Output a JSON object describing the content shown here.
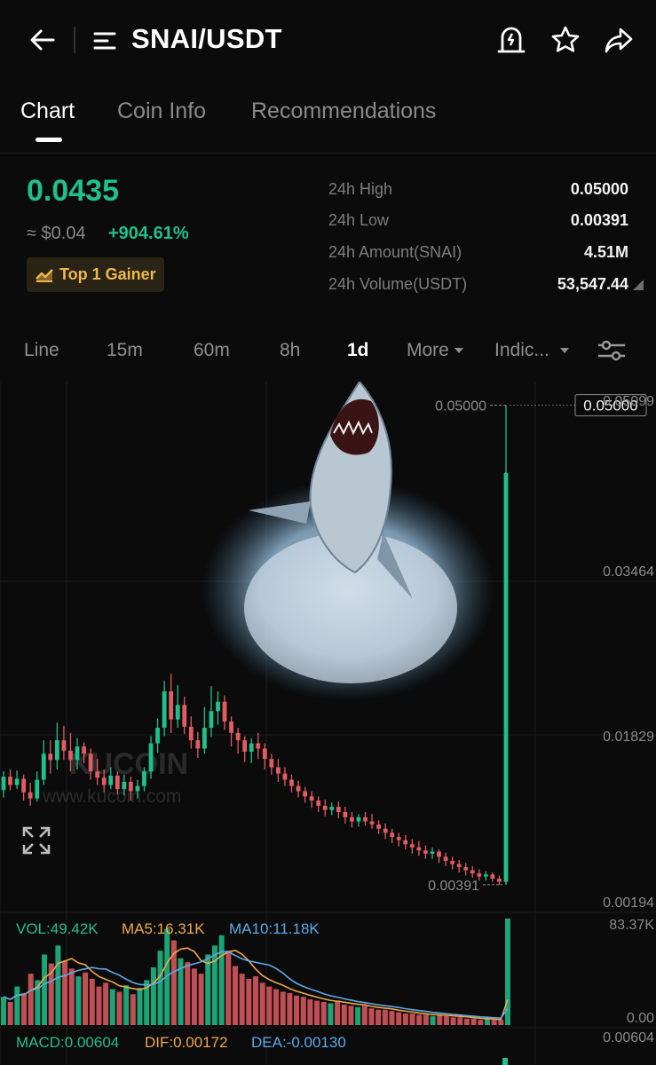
{
  "header": {
    "title": "SNAI/USDT",
    "icons": [
      "back-arrow-icon",
      "menu-lines-icon",
      "price-alert-icon",
      "star-icon",
      "share-icon"
    ]
  },
  "tabs": [
    {
      "label": "Chart",
      "active": true
    },
    {
      "label": "Coin Info",
      "active": false
    },
    {
      "label": "Recommendations",
      "active": false
    }
  ],
  "ticker": {
    "price": "0.0435",
    "usd": "≈ $0.04",
    "change": "+904.61%",
    "badge": "Top 1 Gainer",
    "accent": "#20c08a",
    "badge_color": "#f0b64a"
  },
  "stats": [
    {
      "label": "24h High",
      "value": "0.05000"
    },
    {
      "label": "24h Low",
      "value": "0.00391"
    },
    {
      "label": "24h Amount(SNAI)",
      "value": "4.51M"
    },
    {
      "label": "24h Volume(USDT)",
      "value": "53,547.44"
    }
  ],
  "timeframes": [
    {
      "label": "Line",
      "active": false
    },
    {
      "label": "15m",
      "active": false
    },
    {
      "label": "60m",
      "active": false
    },
    {
      "label": "8h",
      "active": false
    },
    {
      "label": "1d",
      "active": true
    },
    {
      "label": "More",
      "active": false
    },
    {
      "label": "Indic...",
      "active": false
    }
  ],
  "chart": {
    "watermark_brand": "KUCOIN",
    "watermark_url": "www.kucoin.com",
    "high_marker": "0.05000",
    "low_marker": "0.00391",
    "current_tag": "0.05000",
    "up_color": "#20c08a",
    "down_color": "#e05c63"
  },
  "chart_data": {
    "type": "candlestick",
    "y_ticks": [
      "0.05099",
      "0.03464",
      "0.01829",
      "0.00194"
    ],
    "ylim": [
      0.00194,
      0.05099
    ],
    "volume_max_label": "83.37K",
    "volume_zero_label": "0.00",
    "macd_label": "0.00604",
    "candles": [
      [
        0.013,
        0.0143,
        0.0148,
        0.0123
      ],
      [
        0.0143,
        0.0135,
        0.015,
        0.013
      ],
      [
        0.0135,
        0.0141,
        0.0149,
        0.0131
      ],
      [
        0.0141,
        0.0128,
        0.0145,
        0.012
      ],
      [
        0.0128,
        0.0122,
        0.0137,
        0.0115
      ],
      [
        0.0122,
        0.014,
        0.0148,
        0.0119
      ],
      [
        0.014,
        0.0165,
        0.0178,
        0.0135
      ],
      [
        0.0165,
        0.0159,
        0.0178,
        0.0146
      ],
      [
        0.0159,
        0.0178,
        0.0195,
        0.015
      ],
      [
        0.0178,
        0.0168,
        0.0192,
        0.0159
      ],
      [
        0.0168,
        0.0159,
        0.0185,
        0.0148
      ],
      [
        0.0159,
        0.0172,
        0.018,
        0.015
      ],
      [
        0.0172,
        0.0165,
        0.0176,
        0.0156
      ],
      [
        0.0165,
        0.0148,
        0.017,
        0.014
      ],
      [
        0.0148,
        0.0142,
        0.016,
        0.0135
      ],
      [
        0.0142,
        0.0135,
        0.015,
        0.0128
      ],
      [
        0.0135,
        0.0144,
        0.0152,
        0.0131
      ],
      [
        0.0144,
        0.0131,
        0.0148,
        0.0126
      ],
      [
        0.0131,
        0.0138,
        0.0145,
        0.0125
      ],
      [
        0.0138,
        0.0129,
        0.0143,
        0.012
      ],
      [
        0.0129,
        0.0134,
        0.014,
        0.0122
      ],
      [
        0.0134,
        0.0148,
        0.0152,
        0.0129
      ],
      [
        0.0148,
        0.0175,
        0.0182,
        0.0141
      ],
      [
        0.0175,
        0.019,
        0.0199,
        0.0166
      ],
      [
        0.019,
        0.0225,
        0.0235,
        0.0182
      ],
      [
        0.0225,
        0.0198,
        0.0242,
        0.0185
      ],
      [
        0.0198,
        0.0212,
        0.0231,
        0.019
      ],
      [
        0.0212,
        0.0191,
        0.022,
        0.0184
      ],
      [
        0.0191,
        0.0178,
        0.0201,
        0.017
      ],
      [
        0.0178,
        0.017,
        0.0186,
        0.0161
      ],
      [
        0.017,
        0.019,
        0.021,
        0.0165
      ],
      [
        0.019,
        0.0206,
        0.023,
        0.0181
      ],
      [
        0.0206,
        0.0215,
        0.0225,
        0.0193
      ],
      [
        0.0215,
        0.0196,
        0.0221,
        0.0188
      ],
      [
        0.0196,
        0.0185,
        0.0201,
        0.0172
      ],
      [
        0.0185,
        0.0178,
        0.019,
        0.0165
      ],
      [
        0.0178,
        0.0167,
        0.0182,
        0.0157
      ],
      [
        0.0167,
        0.0175,
        0.018,
        0.0156
      ],
      [
        0.0175,
        0.017,
        0.0185,
        0.016
      ],
      [
        0.017,
        0.016,
        0.0175,
        0.015
      ],
      [
        0.016,
        0.0152,
        0.0165,
        0.0145
      ],
      [
        0.0152,
        0.0146,
        0.016,
        0.0138
      ],
      [
        0.0146,
        0.014,
        0.0152,
        0.0134
      ],
      [
        0.014,
        0.0134,
        0.0145,
        0.0128
      ],
      [
        0.0134,
        0.0129,
        0.0139,
        0.0123
      ],
      [
        0.0129,
        0.0124,
        0.0133,
        0.0118
      ],
      [
        0.0124,
        0.012,
        0.0129,
        0.0113
      ],
      [
        0.012,
        0.0115,
        0.0124,
        0.0109
      ],
      [
        0.0115,
        0.0111,
        0.0121,
        0.0105
      ],
      [
        0.0111,
        0.0114,
        0.0118,
        0.0106
      ],
      [
        0.0114,
        0.0109,
        0.0119,
        0.0103
      ],
      [
        0.0109,
        0.0104,
        0.0114,
        0.0098
      ],
      [
        0.0104,
        0.01,
        0.0109,
        0.0094
      ],
      [
        0.01,
        0.0104,
        0.0107,
        0.0095
      ],
      [
        0.0104,
        0.01,
        0.0109,
        0.0096
      ],
      [
        0.01,
        0.0097,
        0.0107,
        0.0093
      ],
      [
        0.0097,
        0.0093,
        0.0101,
        0.0088
      ],
      [
        0.0093,
        0.0089,
        0.0098,
        0.0083
      ],
      [
        0.0089,
        0.0085,
        0.0093,
        0.0079
      ],
      [
        0.0085,
        0.0082,
        0.0089,
        0.0076
      ],
      [
        0.0082,
        0.0078,
        0.0087,
        0.0073
      ],
      [
        0.0078,
        0.0075,
        0.0083,
        0.0069
      ],
      [
        0.0075,
        0.0072,
        0.0081,
        0.0067
      ],
      [
        0.0072,
        0.0069,
        0.0077,
        0.0064
      ],
      [
        0.0069,
        0.0071,
        0.0075,
        0.0064
      ],
      [
        0.0071,
        0.0066,
        0.0073,
        0.006
      ],
      [
        0.0066,
        0.0062,
        0.007,
        0.0057
      ],
      [
        0.0062,
        0.0059,
        0.0066,
        0.0054
      ],
      [
        0.0059,
        0.0056,
        0.0063,
        0.0051
      ],
      [
        0.0056,
        0.0053,
        0.006,
        0.0048
      ],
      [
        0.0053,
        0.005,
        0.0057,
        0.0046
      ],
      [
        0.005,
        0.0047,
        0.0054,
        0.0043
      ],
      [
        0.0047,
        0.0049,
        0.0052,
        0.0043
      ],
      [
        0.0049,
        0.0045,
        0.0051,
        0.0042
      ],
      [
        0.0045,
        0.0042,
        0.0048,
        0.0039
      ],
      [
        0.0042,
        0.0435,
        0.05,
        0.0039
      ]
    ],
    "volume": [
      22,
      18,
      30,
      25,
      40,
      35,
      55,
      48,
      62,
      50,
      44,
      38,
      41,
      36,
      30,
      33,
      28,
      26,
      31,
      24,
      29,
      35,
      45,
      58,
      75,
      66,
      52,
      49,
      44,
      40,
      55,
      62,
      70,
      58,
      46,
      40,
      36,
      38,
      33,
      30,
      28,
      26,
      25,
      23,
      22,
      20,
      19,
      18,
      17,
      19,
      16,
      15,
      14,
      15,
      13,
      12,
      12,
      11,
      10,
      9,
      9,
      8,
      8,
      7,
      8,
      7,
      6,
      6,
      5,
      5,
      4,
      5,
      4,
      4,
      83
    ],
    "indicators": {
      "vol": "VOL:49.42K",
      "ma5": "MA5:16.31K",
      "ma10": "MA10:11.18K",
      "macd": "MACD:0.00604",
      "dif": "DIF:0.00172",
      "dea": "DEA:-0.00130"
    }
  }
}
